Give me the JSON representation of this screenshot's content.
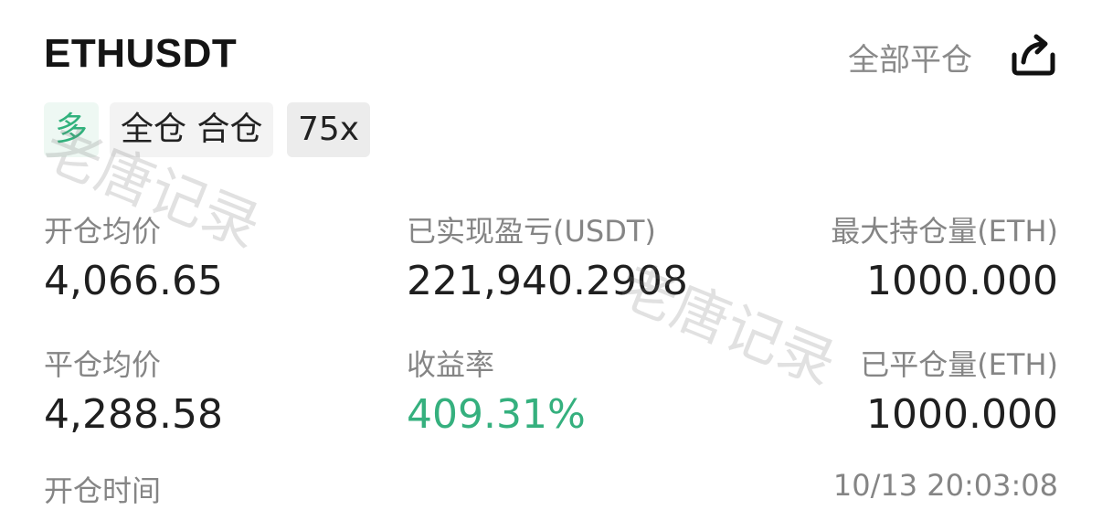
{
  "header": {
    "symbol": "ETHUSDT",
    "close_all_label": "全部平仓",
    "share_icon": "share-icon"
  },
  "tags": {
    "side": "多",
    "margin_mode": "全仓 合仓",
    "leverage": "75x"
  },
  "stats": {
    "open_avg_price_label": "开仓均价",
    "open_avg_price": "4,066.65",
    "realized_pnl_label": "已实现盈亏(USDT)",
    "realized_pnl": "221,940.2908",
    "max_position_label": "最大持仓量(ETH)",
    "max_position": "1000.000",
    "close_avg_price_label": "平仓均价",
    "close_avg_price": "4,288.58",
    "roi_label": "收益率",
    "roi": "409.31%",
    "closed_amount_label": "已平仓量(ETH)",
    "closed_amount": "1000.000",
    "open_time_label": "开仓时间",
    "open_time": "10/13 20:03:08"
  },
  "watermark": {
    "text": "老唐记录"
  },
  "colors": {
    "profit_green": "#35b07e",
    "label_gray": "#858585"
  }
}
